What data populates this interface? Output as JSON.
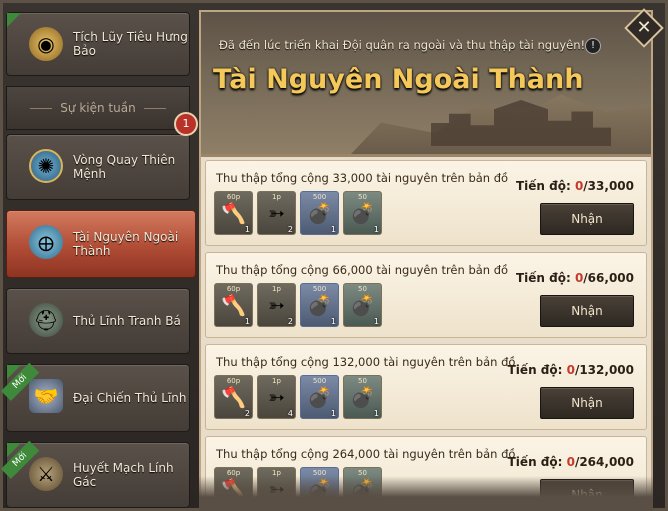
{
  "sidebar": {
    "items": [
      {
        "label": "Tích Lũy Tiêu Hưng Bảo",
        "icon": "coin-icon",
        "ribbon": ""
      },
      {
        "label": "Vòng Quay Thiên Mệnh",
        "icon": "wheel-icon",
        "badge": "1"
      },
      {
        "label": "Tài Nguyên Ngoài Thành",
        "icon": "globe-icon",
        "active": true
      },
      {
        "label": "Thủ Lĩnh Tranh Bá",
        "icon": "helmet-icon"
      },
      {
        "label": "Đại Chiến Thủ Lĩnh",
        "icon": "handshake-shield-icon",
        "ribbon": "Mới"
      },
      {
        "label": "Huyết Mạch Lính Gác",
        "icon": "soldier-icon",
        "ribbon": "Mới"
      }
    ],
    "week_label": "Sự kiện tuần",
    "badge_count": "1"
  },
  "banner": {
    "description": "Đã đến lúc triển khai Đội quân ra ngoài và thu thập tài nguyên!",
    "title": "Tài Nguyên Ngoài Thành",
    "info": "!"
  },
  "tasks": [
    {
      "title": "Thu thập tổng cộng 33,000 tài nguyên trên bản đồ",
      "progress_label": "Tiến độ: ",
      "current": "0",
      "target": "/33,000",
      "button": "Nhận",
      "rewards": [
        {
          "cap": "60p",
          "count": "1"
        },
        {
          "cap": "1p",
          "count": "2"
        },
        {
          "cap": "500",
          "count": "1"
        },
        {
          "cap": "50",
          "count": "1"
        }
      ]
    },
    {
      "title": "Thu thập tổng cộng 66,000 tài nguyên trên bản đồ",
      "progress_label": "Tiến độ: ",
      "current": "0",
      "target": "/66,000",
      "button": "Nhận",
      "rewards": [
        {
          "cap": "60p",
          "count": "1"
        },
        {
          "cap": "1p",
          "count": "2"
        },
        {
          "cap": "500",
          "count": "1"
        },
        {
          "cap": "50",
          "count": "1"
        }
      ]
    },
    {
      "title": "Thu thập tổng cộng 132,000 tài nguyên trên bản đồ",
      "progress_label": "Tiến độ: ",
      "current": "0",
      "target": "/132,000",
      "button": "Nhận",
      "rewards": [
        {
          "cap": "60p",
          "count": "2"
        },
        {
          "cap": "1p",
          "count": "4"
        },
        {
          "cap": "500",
          "count": "1"
        },
        {
          "cap": "50",
          "count": "1"
        }
      ]
    },
    {
      "title": "Thu thập tổng cộng 264,000 tài nguyên trên bản đồ",
      "progress_label": "Tiến độ: ",
      "current": "0",
      "target": "/264,000",
      "button": "Nhận",
      "rewards": [
        {
          "cap": "60p",
          "count": ""
        },
        {
          "cap": "1p",
          "count": ""
        },
        {
          "cap": "500",
          "count": ""
        },
        {
          "cap": "50",
          "count": ""
        }
      ]
    }
  ],
  "close_label": "✕"
}
